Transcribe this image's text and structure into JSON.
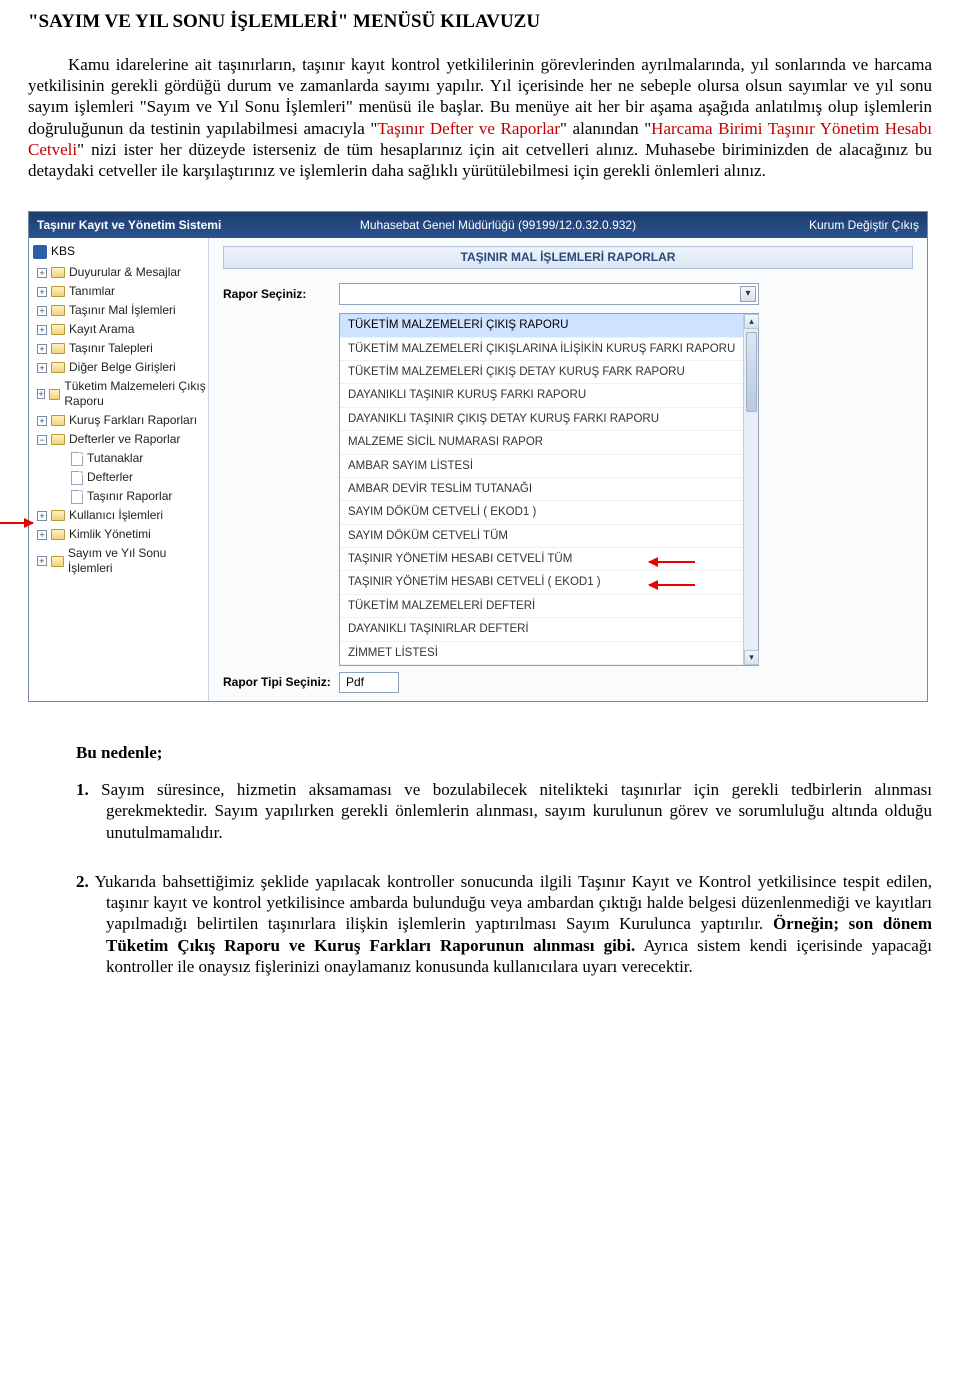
{
  "title": "\"SAYIM VE YIL SONU İŞLEMLERİ\" MENÜSÜ KILAVUZU",
  "intro_html": "Kamu idarelerine ait taşınırların, taşınır kayıt kontrol yetkililerinin görevlerinden ayrılmalarında, yıl sonlarında ve harcama yetkilisinin gerekli gördüğü durum ve zamanlarda sayımı yapılır. Yıl içerisinde her ne sebeple olursa olsun sayımlar ve yıl sonu sayım işlemleri \"Sayım ve Yıl Sonu İşlemleri\" menüsü ile başlar. Bu menüye ait her bir aşama aşağıda anlatılmış olup işlemlerin doğruluğunun da testinin yapılabilmesi amacıyla \"<span class=\"red\">Taşınır Defter ve Raporlar</span>\" alanından \"<span class=\"red\">Harcama Birimi Taşınır Yönetim Hesabı Cetveli</span>\" nizi ister her düzeyde isterseniz de tüm hesaplarınız için ait cetvelleri alınız. Muhasebe biriminizden de alacağınız bu detaydaki cetveller ile karşılaştırınız ve işlemlerin daha sağlıklı yürütülebilmesi için gerekli önlemleri alınız.",
  "app": {
    "header_left": "Taşınır Kayıt ve Yönetim Sistemi",
    "header_center": "Muhasebat Genel Müdürlüğü (99199/12.0.32.0.932)",
    "header_right": "Kurum Değiştir   Çıkış",
    "root_label": "KBS",
    "tree": [
      {
        "label": "Duyurular & Mesajlar",
        "type": "folder"
      },
      {
        "label": "Tanımlar",
        "type": "folder"
      },
      {
        "label": "Taşınır Mal İşlemleri",
        "type": "folder"
      },
      {
        "label": "Kayıt Arama",
        "type": "folder"
      },
      {
        "label": "Taşınır Talepleri",
        "type": "folder"
      },
      {
        "label": "Diğer Belge Girişleri",
        "type": "folder"
      },
      {
        "label": "Tüketim Malzemeleri Çıkış Raporu",
        "type": "folder"
      },
      {
        "label": "Kuruş Farkları Raporları",
        "type": "folder"
      },
      {
        "label": "Defterler ve Raporlar",
        "type": "folder",
        "expanded": true,
        "children": [
          {
            "label": "Tutanaklar",
            "type": "page"
          },
          {
            "label": "Defterler",
            "type": "page"
          },
          {
            "label": "Taşınır Raporlar",
            "type": "page"
          }
        ]
      },
      {
        "label": "Kullanıcı İşlemleri",
        "type": "folder"
      },
      {
        "label": "Kimlik Yönetimi",
        "type": "folder"
      },
      {
        "label": "Sayım ve Yıl Sonu İşlemleri",
        "type": "folder"
      }
    ],
    "panel_title": "TAŞINIR MAL İŞLEMLERİ RAPORLAR",
    "select_label": "Rapor Seçiniz:",
    "dropdown": [
      "TÜKETİM MALZEMELERİ ÇIKIŞ RAPORU",
      "TÜKETİM MALZEMELERİ ÇIKIŞLARINA İLİŞİKİN KURUŞ FARKI RAPORU",
      "TÜKETİM MALZEMELERİ ÇIKIŞ DETAY KURUŞ FARK RAPORU",
      "DAYANIKLI TAŞINIR KURUŞ FARKI RAPORU",
      "DAYANIKLI TAŞINIR ÇIKIŞ DETAY KURUŞ FARKI RAPORU",
      "MALZEME SİCİL NUMARASI RAPOR",
      "AMBAR SAYIM LİSTESİ",
      "AMBAR DEVİR TESLİM TUTANAĞI",
      "SAYIM DÖKÜM CETVELİ ( EKOD1 )",
      "SAYIM DÖKÜM CETVELİ TÜM",
      "TAŞINIR YÖNETİM HESABI CETVELİ TÜM",
      "TAŞINIR YÖNETİM HESABI CETVELİ ( EKOD1 )",
      "TÜKETİM MALZEMELERİ DEFTERİ",
      "DAYANIKLI TAŞINIRLAR DEFTERİ",
      "ZİMMET LİSTESİ"
    ],
    "selected_index": 0,
    "rapor_tipi_label": "Rapor Tipi Seçiniz:",
    "rapor_tipi_value": "Pdf"
  },
  "sub_heading": "Bu nedenle;",
  "item1_html": "<span class=\"num\">1.</span> Sayım süresince, hizmetin aksamaması ve bozulabilecek nitelikteki taşınırlar için gerekli tedbirlerin alınması gerekmektedir. Sayım yapılırken gerekli önlemlerin alınması, sayım kurulunun görev ve sorumluluğu altında olduğu unutulmamalıdır.",
  "item2_html": "<span class=\"num\">2.</span> Yukarıda bahsettiğimiz şeklide yapılacak kontroller sonucunda ilgili Taşınır Kayıt ve Kontrol yetkilisince tespit edilen, taşınır kayıt ve kontrol yetkilisince ambarda bulunduğu veya ambardan çıktığı halde belgesi düzenlenmediği ve kayıtları yapılmadığı belirtilen taşınırlara ilişkin işlemlerin yaptırılması Sayım Kurulunca yaptırılır. <b>Örneğin; son dönem Tüketim Çıkış Raporu ve Kuruş Farkları Raporunun alınması gibi.</b> Ayrıca sistem kendi içerisinde yapacağı kontroller ile onaysız fişlerinizi onaylamanız konusunda kullanıcılara uyarı verecektir."
}
